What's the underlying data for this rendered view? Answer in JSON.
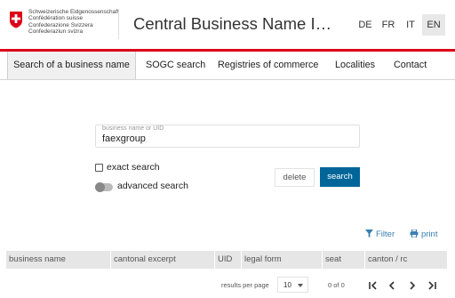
{
  "header": {
    "federal_names": [
      "Schweizerische Eidgenossenschaft",
      "Confédération suisse",
      "Confederazione Svizzera",
      "Confederaziun svizra"
    ],
    "app_title": "Central Business Name I…",
    "languages": [
      {
        "label": "DE",
        "active": false
      },
      {
        "label": "FR",
        "active": false
      },
      {
        "label": "IT",
        "active": false
      },
      {
        "label": "EN",
        "active": true
      }
    ],
    "accent_color": "#dc0018"
  },
  "nav": {
    "tabs": [
      {
        "label": "Search of a business name",
        "active": true
      },
      {
        "label": "SOGC search",
        "active": false
      },
      {
        "label": "Registries of commerce",
        "active": false
      },
      {
        "label": "Localities",
        "active": false
      },
      {
        "label": "Contact",
        "active": false
      }
    ]
  },
  "search": {
    "field_label": "business name or UID",
    "field_value": "faexgroup",
    "exact_search_label": "exact search",
    "exact_search_checked": false,
    "advanced_search_label": "advanced search",
    "advanced_search_on": false,
    "delete_label": "delete",
    "search_label": "search",
    "search_button_color": "#006699"
  },
  "table": {
    "filter_label": "Filter",
    "print_label": "print",
    "columns": [
      "business name",
      "cantonal excerpt",
      "UID",
      "legal form",
      "seat",
      "canton / rc"
    ]
  },
  "pagination": {
    "results_per_page_label": "results per page",
    "results_per_page_value": "10",
    "count_text": "0 of 0",
    "icons": [
      "first-page-icon",
      "previous-page-icon",
      "next-page-icon",
      "last-page-icon"
    ]
  }
}
